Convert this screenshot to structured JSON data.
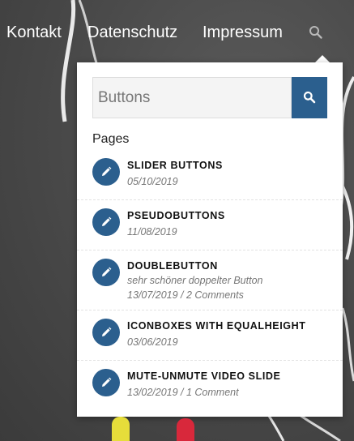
{
  "nav": {
    "items": [
      {
        "label": "Kontakt"
      },
      {
        "label": "Datenschutz"
      },
      {
        "label": "Impressum"
      }
    ],
    "search_icon": "search-icon"
  },
  "search": {
    "value": "Buttons",
    "placeholder": "",
    "button_icon": "search-icon"
  },
  "results": {
    "section_label": "Pages",
    "items": [
      {
        "title": "SLIDER BUTTONS",
        "excerpt": "",
        "meta": "05/10/2019",
        "icon": "pencil-icon"
      },
      {
        "title": "PSEUDOBUTTONS",
        "excerpt": "",
        "meta": "11/08/2019",
        "icon": "pencil-icon"
      },
      {
        "title": "DOUBLEBUTTON",
        "excerpt": "sehr schöner doppelter Button",
        "meta": "13/07/2019 / 2 Comments",
        "icon": "pencil-icon"
      },
      {
        "title": "ICONBOXES WITH EQUALHEIGHT",
        "excerpt": "",
        "meta": "03/06/2019",
        "icon": "pencil-icon"
      },
      {
        "title": "MUTE-UNMUTE VIDEO SLIDE",
        "excerpt": "",
        "meta": "13/02/2019 / 1 Comment",
        "icon": "pencil-icon"
      }
    ]
  },
  "colors": {
    "accent": "#2b5f8e",
    "background": "#4a4a4a"
  }
}
